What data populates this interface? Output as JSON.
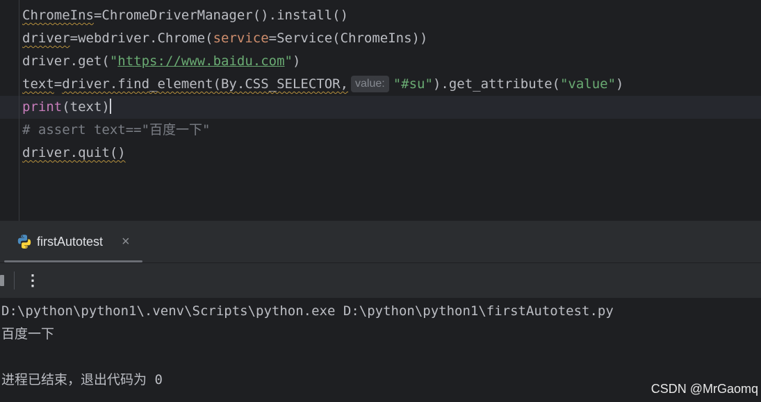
{
  "editor": {
    "lines": [
      [
        "ChromeIns",
        "=",
        "ChromeDriverManager().install()"
      ],
      [
        "driver",
        "=",
        "webdriver.Chrome(",
        "service",
        "=Service(ChromeIns))"
      ],
      [
        "driver.get(",
        "\"",
        "https://www.baidu.com",
        "\"",
        ")"
      ],
      [
        "text",
        "=",
        "driver.find_element(By.CSS_SELECTOR,",
        "value:",
        "\"#su\"",
        ").get_attribute(",
        "\"value\"",
        ")"
      ],
      [
        "print",
        "(text)"
      ],
      [
        "# assert text==\"百度一下\""
      ],
      [
        "driver.quit()"
      ]
    ]
  },
  "run_panel": {
    "tab_label": "firstAutotest",
    "tab_close": "×",
    "more_glyph": "⋮"
  },
  "console": {
    "lines": [
      "D:\\python\\python1\\.venv\\Scripts\\python.exe D:\\python\\python1\\firstAutotest.py",
      "百度一下",
      "",
      "进程已结束，退出代码为 0"
    ]
  },
  "watermark": "CSDN @MrGaomq",
  "colors": {
    "editor_bg": "#1e1f22",
    "keyword": "#c77dbb",
    "string": "#6aab73",
    "parameter": "#cf8e6d",
    "comment": "#7a7e85"
  }
}
